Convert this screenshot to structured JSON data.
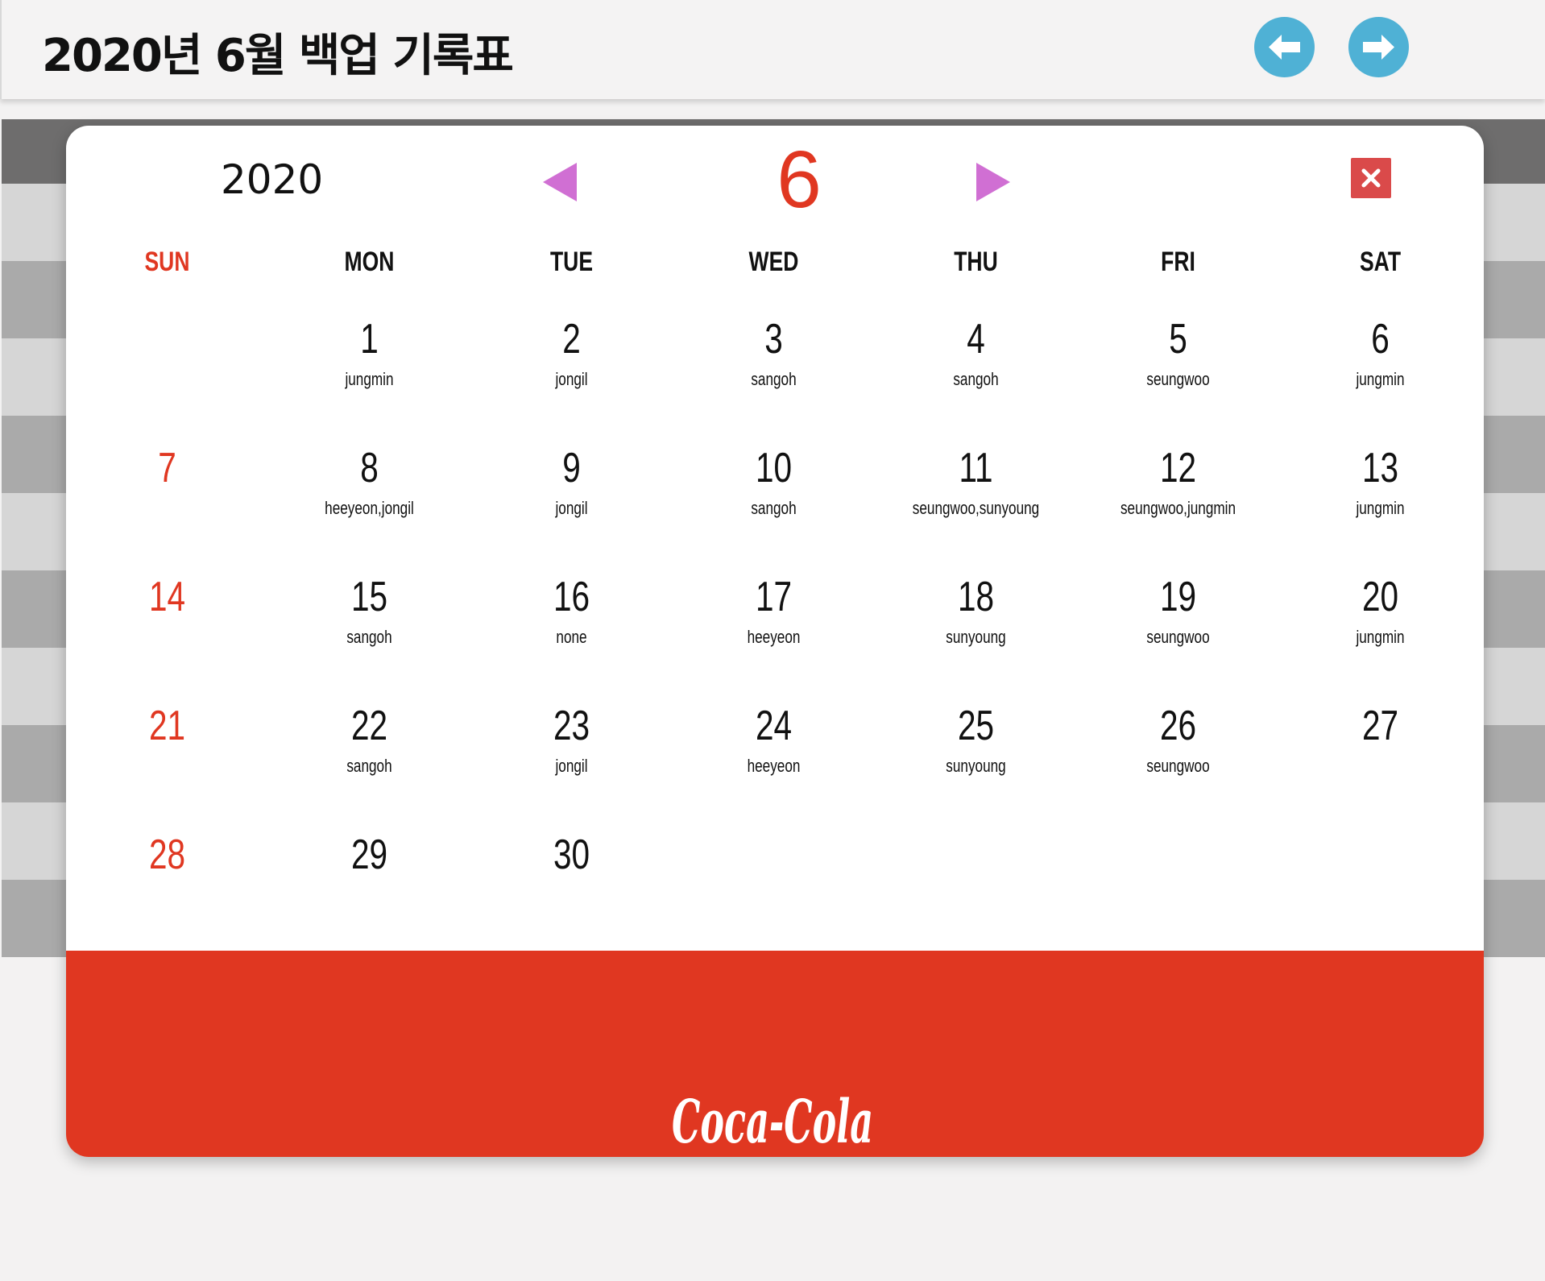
{
  "header": {
    "title": "2020년 6월 백업 기록표",
    "prev_icon": "arrow-left-icon",
    "next_icon": "arrow-right-icon",
    "accent": "#4fb1d5"
  },
  "calendar": {
    "year": "2020",
    "month": "6",
    "month_color": "#e03721",
    "nav_color": "#d06fd3",
    "weekdays": [
      "SUN",
      "MON",
      "TUE",
      "WED",
      "THU",
      "FRI",
      "SAT"
    ],
    "weeks": [
      [
        {
          "day": "",
          "names": ""
        },
        {
          "day": "1",
          "names": "jungmin"
        },
        {
          "day": "2",
          "names": "jongil"
        },
        {
          "day": "3",
          "names": "sangoh"
        },
        {
          "day": "4",
          "names": "sangoh"
        },
        {
          "day": "5",
          "names": "seungwoo"
        },
        {
          "day": "6",
          "names": "jungmin"
        }
      ],
      [
        {
          "day": "7",
          "names": ""
        },
        {
          "day": "8",
          "names": "heeyeon,jongil"
        },
        {
          "day": "9",
          "names": "jongil"
        },
        {
          "day": "10",
          "names": "sangoh"
        },
        {
          "day": "11",
          "names": "seungwoo,sunyoung"
        },
        {
          "day": "12",
          "names": "seungwoo,jungmin"
        },
        {
          "day": "13",
          "names": "jungmin"
        }
      ],
      [
        {
          "day": "14",
          "names": ""
        },
        {
          "day": "15",
          "names": "sangoh"
        },
        {
          "day": "16",
          "names": "none"
        },
        {
          "day": "17",
          "names": "heeyeon"
        },
        {
          "day": "18",
          "names": "sunyoung"
        },
        {
          "day": "19",
          "names": "seungwoo"
        },
        {
          "day": "20",
          "names": "jungmin"
        }
      ],
      [
        {
          "day": "21",
          "names": ""
        },
        {
          "day": "22",
          "names": "sangoh"
        },
        {
          "day": "23",
          "names": "jongil"
        },
        {
          "day": "24",
          "names": "heeyeon"
        },
        {
          "day": "25",
          "names": "sunyoung"
        },
        {
          "day": "26",
          "names": "seungwoo"
        },
        {
          "day": "27",
          "names": ""
        }
      ],
      [
        {
          "day": "28",
          "names": ""
        },
        {
          "day": "29",
          "names": ""
        },
        {
          "day": "30",
          "names": ""
        },
        {
          "day": "",
          "names": ""
        },
        {
          "day": "",
          "names": ""
        },
        {
          "day": "",
          "names": ""
        },
        {
          "day": "",
          "names": ""
        }
      ]
    ]
  },
  "footer": {
    "logo_text": "Coca-Cola",
    "color": "#e03721"
  }
}
